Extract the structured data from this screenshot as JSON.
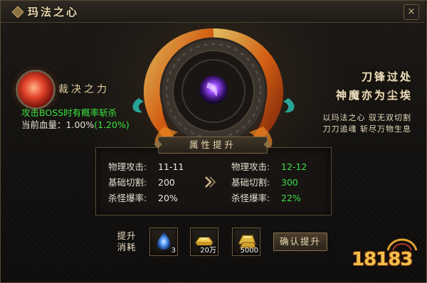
{
  "window": {
    "title": "玛法之心",
    "close_label": "×"
  },
  "skill": {
    "name": "裁决之力",
    "icon": "red-spiral-orb-icon",
    "description": "攻击BOSS时有概率斩杀",
    "hp_label": "当前血量：",
    "hp_current": "1.00%",
    "hp_next": "(1.20%)"
  },
  "slogan": {
    "line1": "刀锋过处",
    "line2": "神魔亦为尘埃",
    "sub1": "以玛法之心 驭无双切割",
    "sub2": "刀刀追魂 斩尽万物生息"
  },
  "attributes": {
    "header": "属性提升",
    "current": [
      {
        "label": "物理攻击:",
        "value": "11-11"
      },
      {
        "label": "基础切割:",
        "value": "200"
      },
      {
        "label": "杀怪爆率:",
        "value": "20%"
      }
    ],
    "next": [
      {
        "label": "物理攻击:",
        "value": "12-12"
      },
      {
        "label": "基础切割:",
        "value": "300"
      },
      {
        "label": "杀怪爆率:",
        "value": "22%"
      }
    ],
    "arrow_icon": "double-chevron-right-icon"
  },
  "cost": {
    "label_line1": "提升",
    "label_line2": "消耗",
    "items": [
      {
        "icon": "blue-flame-stone-icon",
        "count": "3"
      },
      {
        "icon": "gold-ingot-icon",
        "count": "20万"
      },
      {
        "icon": "gold-bar-stack-icon",
        "count": "5000"
      }
    ],
    "confirm_label": "确认提升"
  },
  "watermark": {
    "text": "18183"
  },
  "colors": {
    "accent_gold": "#e7d7ad",
    "highlight_green": "#3fe046",
    "frame_border": "#5a4a34"
  }
}
